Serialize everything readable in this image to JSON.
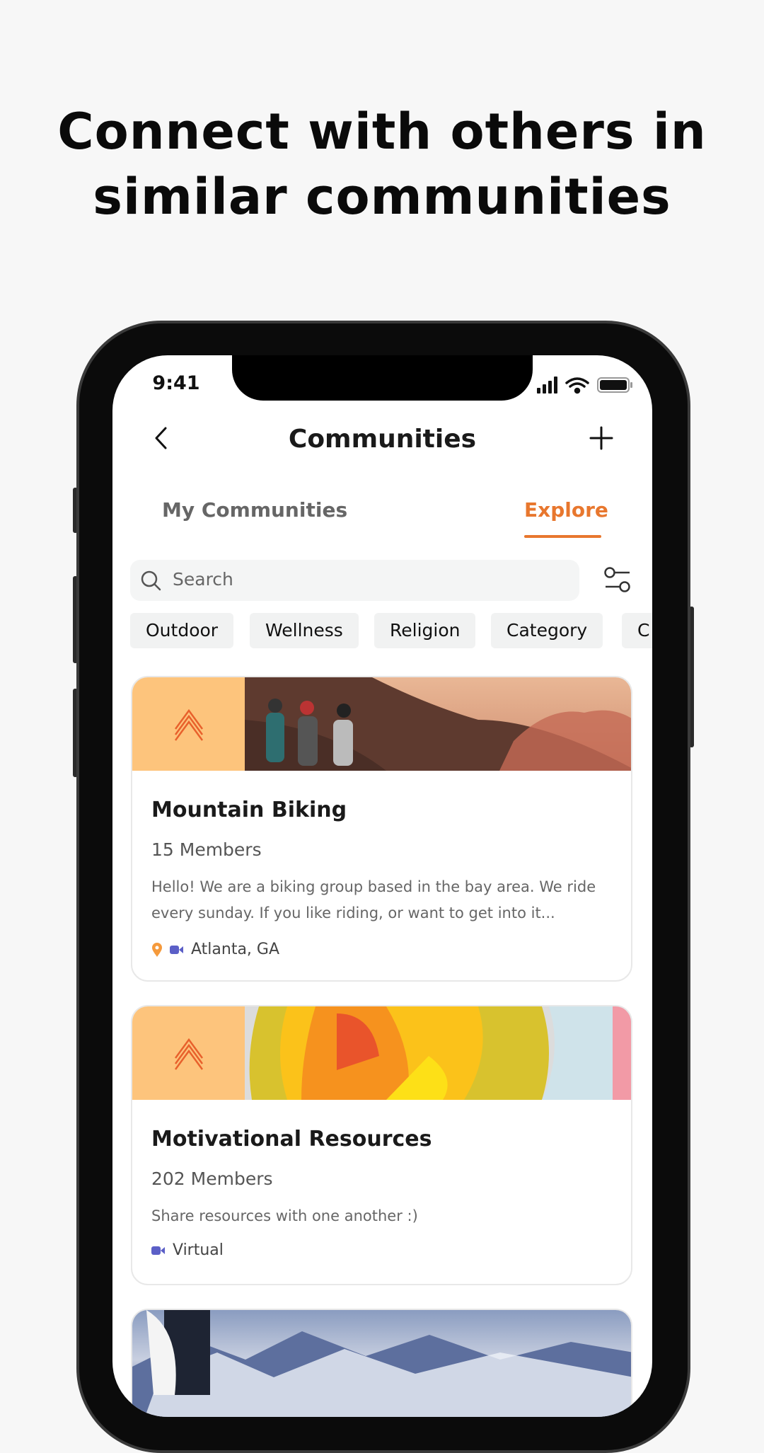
{
  "headline": {
    "line1": "Connect with others in",
    "line2": "similar communities"
  },
  "status_bar": {
    "time": "9:41"
  },
  "header": {
    "title": "Communities",
    "back_icon": "chevron-left-icon",
    "add_icon": "plus-icon"
  },
  "tabs": [
    {
      "label": "My Communities",
      "active": false
    },
    {
      "label": "Explore",
      "active": true
    }
  ],
  "search": {
    "placeholder": "Search"
  },
  "chips": [
    "Outdoor",
    "Wellness",
    "Religion",
    "Category",
    "C"
  ],
  "colors": {
    "accent": "#e8772e",
    "logo_bg": "#fdc47c",
    "video": "#5b5fc7",
    "pin": "#f59a3c"
  },
  "communities": [
    {
      "name": "Mountain Biking",
      "members": "15 Members",
      "description": "Hello! We are a biking group based in the bay area. We ride every sunday. If you like riding, or want to get into it...",
      "location": "Atlanta, GA",
      "in_person": true,
      "virtual": true
    },
    {
      "name": "Motivational Resources",
      "members": "202 Members",
      "description": "Share resources with one another :)",
      "location": "Virtual",
      "in_person": false,
      "virtual": true
    }
  ]
}
